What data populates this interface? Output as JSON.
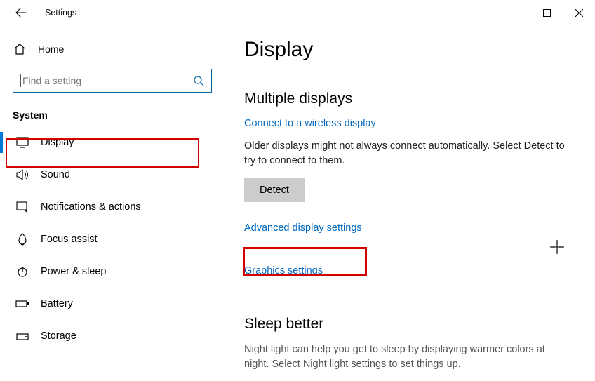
{
  "titlebar": {
    "title": "Settings"
  },
  "sidebar": {
    "home": "Home",
    "search_placeholder": "Find a setting",
    "category": "System",
    "items": [
      {
        "label": "Display"
      },
      {
        "label": "Sound"
      },
      {
        "label": "Notifications & actions"
      },
      {
        "label": "Focus assist"
      },
      {
        "label": "Power & sleep"
      },
      {
        "label": "Battery"
      },
      {
        "label": "Storage"
      }
    ]
  },
  "main": {
    "page_title": "Display",
    "multiple_displays": {
      "heading": "Multiple displays",
      "connect_link": "Connect to a wireless display",
      "detect_text": "Older displays might not always connect automatically. Select Detect to try to connect to them.",
      "detect_button": "Detect",
      "advanced_link": "Advanced display settings",
      "graphics_link": "Graphics settings"
    },
    "sleep_better": {
      "heading": "Sleep better",
      "description": "Night light can help you get to sleep by displaying warmer colors at night. Select Night light settings to set things up."
    }
  }
}
